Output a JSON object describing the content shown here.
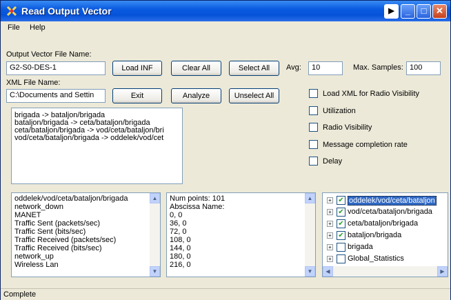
{
  "window": {
    "title": "Read Output Vector"
  },
  "menu": [
    "File",
    "Help"
  ],
  "output_vector": {
    "label": "Output Vector File Name:",
    "value": "G2-S0-DES-1"
  },
  "xml_file": {
    "label": "XML File Name:",
    "value": "C:\\Documents and Settin"
  },
  "buttons": {
    "load_inf": "Load INF",
    "clear_all": "Clear All",
    "select_all": "Select All",
    "exit": "Exit",
    "analyze": "Analyze",
    "unselect_all": "Unselect All"
  },
  "avg": {
    "label": "Avg:",
    "value": "10"
  },
  "max_samples": {
    "label": "Max. Samples:",
    "value": "100"
  },
  "checkboxes": [
    {
      "label": "Load XML for Radio Visibility",
      "checked": false
    },
    {
      "label": "Utilization",
      "checked": false
    },
    {
      "label": "Radio Visibility",
      "checked": false
    },
    {
      "label": "Message completion rate",
      "checked": false
    },
    {
      "label": "Delay",
      "checked": false
    }
  ],
  "routes": [
    "brigada -> bataljon/brigada",
    "bataljon/brigada -> ceta/bataljon/brigada",
    "ceta/bataljon/brigada -> vod/ceta/bataljon/bri",
    "vod/ceta/bataljon/brigada -> oddelek/vod/cet"
  ],
  "statistics": [
    "oddelek/vod/ceta/bataljon/brigada",
    "network_down",
    "MANET",
    "Traffic Sent (packets/sec)",
    "Traffic Sent (bits/sec)",
    "Traffic Received (packets/sec)",
    "Traffic Received (bits/sec)",
    "network_up",
    "Wireless Lan"
  ],
  "data_points": [
    "Num points: 101",
    "Abscissa Name:",
    "0, 0",
    "36, 0",
    "72, 0",
    "108, 0",
    "144, 0",
    "180, 0",
    "216, 0"
  ],
  "tree": [
    {
      "label": "oddelek/vod/ceta/bataljon",
      "checked": true,
      "selected": true
    },
    {
      "label": "vod/ceta/bataljon/brigada",
      "checked": true,
      "selected": false
    },
    {
      "label": "ceta/bataljon/brigada",
      "checked": true,
      "selected": false
    },
    {
      "label": "bataljon/brigada",
      "checked": true,
      "selected": false
    },
    {
      "label": "brigada",
      "checked": false,
      "selected": false
    },
    {
      "label": "Global_Statistics",
      "checked": false,
      "selected": false
    }
  ],
  "status": "Complete",
  "colors": {
    "titlebar": "#0553d8",
    "selection": "#316ac5",
    "check": "#21a121"
  }
}
